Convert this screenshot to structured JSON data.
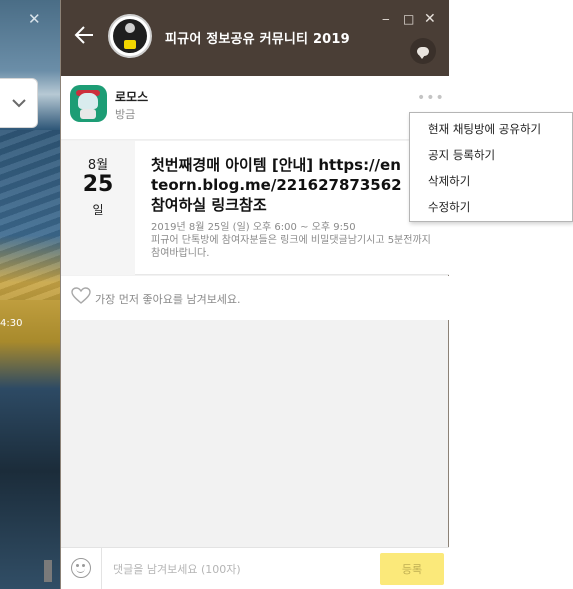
{
  "background_window": {
    "close_glyph": "✕",
    "dropdown_icon": "chevron-down",
    "time_text": "4:30"
  },
  "window": {
    "title": "피규어 정보공유 커뮤니티 2019",
    "back_icon": "arrow-left",
    "controls": {
      "minimize": "‒",
      "maximize": "□",
      "close": "✕"
    },
    "titlebar_color": "#4a3e36"
  },
  "post": {
    "author": "로모스",
    "time": "방금",
    "more_icon": "•••"
  },
  "event": {
    "month": "8월",
    "day": "25",
    "weekday": "일",
    "title": "첫번째경매 아이템 [안내] https://enteorn.blog.me/221627873562 참여하실 링크참조",
    "datetime": "2019년 8월 25일 (일) 오후 6:00 ~ 오후 9:50",
    "description": "피규어 단톡방에 참여자분들은 링크에 비밀댓글남기시고 5분전까지 참여바랍니다."
  },
  "like": {
    "text": "가장 먼저 좋아요를 남겨보세요."
  },
  "comment": {
    "placeholder": "댓글을 남겨보세요 (100자)",
    "submit_label": "등록",
    "submit_color": "#fbe97a"
  },
  "context_menu": {
    "items": [
      "현재 채팅방에 공유하기",
      "공지 등록하기",
      "삭제하기",
      "수정하기"
    ]
  }
}
